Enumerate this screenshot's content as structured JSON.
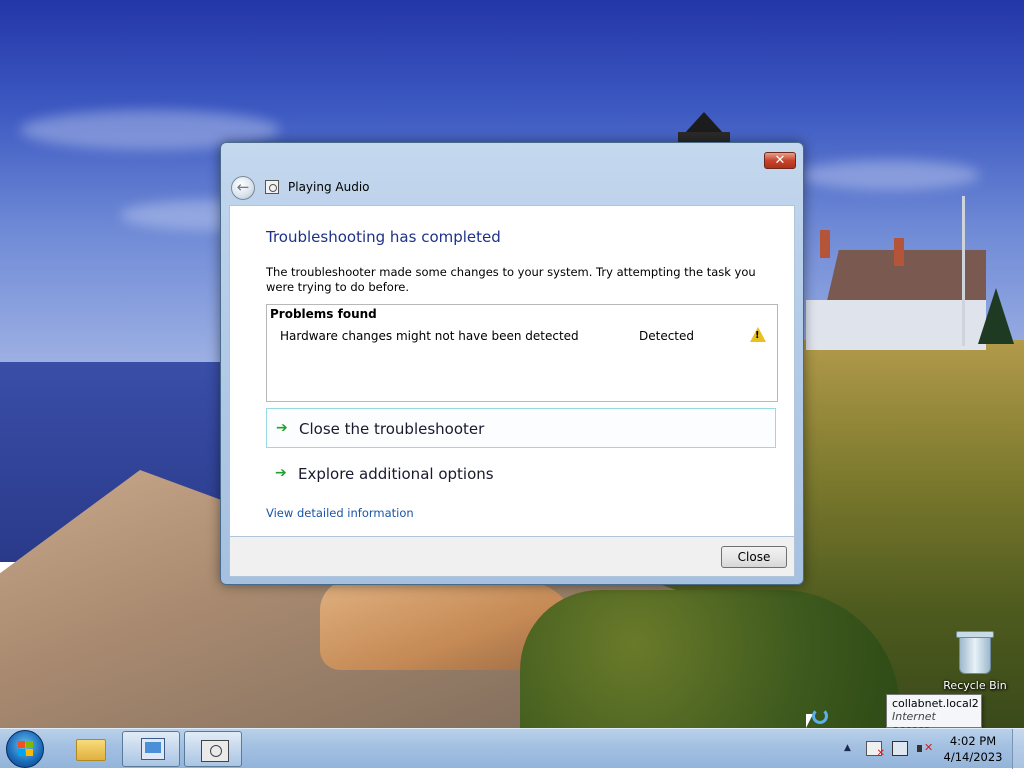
{
  "dialog": {
    "title": "Playing Audio",
    "heading": "Troubleshooting has completed",
    "description": "The troubleshooter made some changes to your system. Try attempting the task you were trying to do before.",
    "problems": {
      "header": "Problems found",
      "items": [
        {
          "description": "Hardware changes might not have been detected",
          "status": "Detected",
          "icon": "warning-icon"
        }
      ]
    },
    "options": [
      {
        "label": "Close the troubleshooter",
        "icon": "green-arrow-icon"
      },
      {
        "label": "Explore additional options",
        "icon": "green-arrow-icon"
      }
    ],
    "detail_link": "View detailed information",
    "close_button": "Close"
  },
  "desktop": {
    "recycle_bin_label": "Recycle Bin",
    "tooltip": {
      "network": "collabnet.local",
      "count": "2",
      "status": "Internet access"
    }
  },
  "taskbar": {
    "clock_time": "4:02 PM",
    "clock_date": "4/14/2023"
  },
  "colors": {
    "heading": "#1e3287",
    "link": "#1a55a5",
    "accent_arrow": "#22a030",
    "warning": "#e8c020"
  }
}
